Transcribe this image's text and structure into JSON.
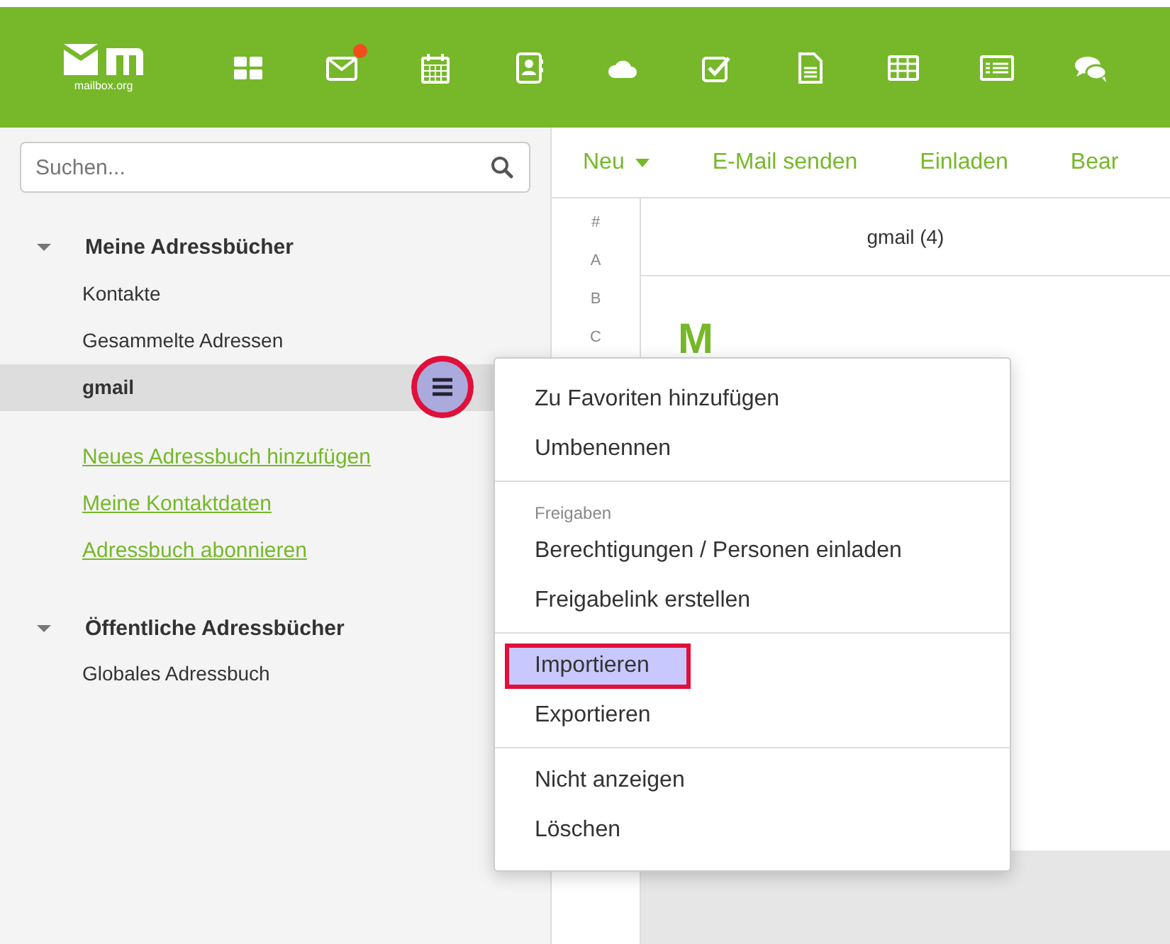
{
  "header": {
    "logo_text": "mailbox.org",
    "apps": [
      {
        "kind": "portal",
        "notification": false
      },
      {
        "kind": "mail",
        "notification": true
      },
      {
        "kind": "calendar",
        "notification": false
      },
      {
        "kind": "contacts",
        "notification": false
      },
      {
        "kind": "drive",
        "notification": false
      },
      {
        "kind": "tasks",
        "notification": false
      },
      {
        "kind": "document",
        "notification": false
      },
      {
        "kind": "spreadsheet",
        "notification": false
      },
      {
        "kind": "presentation",
        "notification": false
      },
      {
        "kind": "chat",
        "notification": false
      }
    ]
  },
  "sidebar": {
    "search": {
      "placeholder": "Suchen..."
    },
    "sections": [
      {
        "title": "Meine Adressbücher",
        "expanded": true,
        "items": [
          {
            "label": "Kontakte",
            "selected": false
          },
          {
            "label": "Gesammelte Adressen",
            "selected": false
          },
          {
            "label": "gmail",
            "selected": true,
            "menu_button": {
              "highlighted": true
            }
          }
        ],
        "links": [
          "Neues Adressbuch hinzufügen",
          "Meine Kontaktdaten",
          "Adressbuch abonnieren"
        ]
      },
      {
        "title": "Öffentliche Adressbücher",
        "expanded": true,
        "items": [
          {
            "label": "Globales Adressbuch",
            "selected": false
          }
        ]
      }
    ]
  },
  "toolbar": [
    {
      "label": "Neu",
      "kind": "dropdown"
    },
    {
      "label": "E-Mail senden",
      "kind": "action"
    },
    {
      "label": "Einladen",
      "kind": "action"
    },
    {
      "label": "Bear",
      "kind": "action"
    }
  ],
  "alphabet": [
    "#",
    "A",
    "B",
    "C"
  ],
  "list": {
    "title": "gmail (4)",
    "letter": "M"
  },
  "context_menu": {
    "groups": [
      {
        "items": [
          {
            "label": "Zu Favoriten hinzufügen",
            "highlighted": false
          },
          {
            "label": "Umbenennen",
            "highlighted": false
          }
        ]
      },
      {
        "header": "Freigaben",
        "items": [
          {
            "label": "Berechtigungen / Personen einladen",
            "highlighted": false
          },
          {
            "label": "Freigabelink erstellen",
            "highlighted": false
          }
        ]
      },
      {
        "items": [
          {
            "label": "Importieren",
            "highlighted": true
          },
          {
            "label": "Exportieren",
            "highlighted": false
          }
        ]
      },
      {
        "items": [
          {
            "label": "Nicht anzeigen",
            "highlighted": false
          },
          {
            "label": "Löschen",
            "highlighted": false
          }
        ]
      }
    ]
  }
}
